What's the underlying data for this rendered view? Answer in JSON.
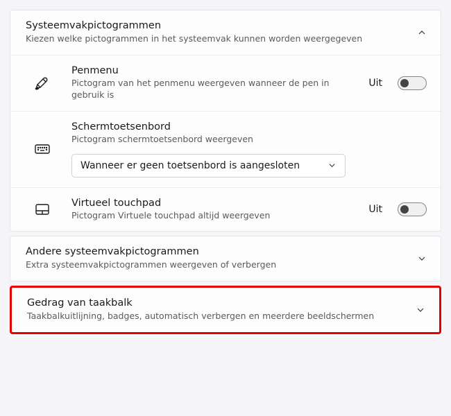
{
  "section_tray": {
    "title": "Systeemvakpictogrammen",
    "desc": "Kiezen welke pictogrammen in het systeemvak kunnen worden weergegeven"
  },
  "pen": {
    "title": "Penmenu",
    "desc": "Pictogram van het penmenu weergeven wanneer de pen in gebruik is",
    "state": "Uit"
  },
  "keyboard": {
    "title": "Schermtoetsenbord",
    "desc": "Pictogram schermtoetsenbord weergeven",
    "select_value": "Wanneer er geen toetsenbord is aangesloten"
  },
  "touchpad": {
    "title": "Virtueel touchpad",
    "desc": "Pictogram Virtuele touchpad altijd weergeven",
    "state": "Uit"
  },
  "section_other": {
    "title": "Andere systeemvakpictogrammen",
    "desc": "Extra systeemvakpictogrammen weergeven of verbergen"
  },
  "section_behavior": {
    "title": "Gedrag van taakbalk",
    "desc": "Taakbalkuitlijning, badges, automatisch verbergen en meerdere beeldschermen"
  }
}
